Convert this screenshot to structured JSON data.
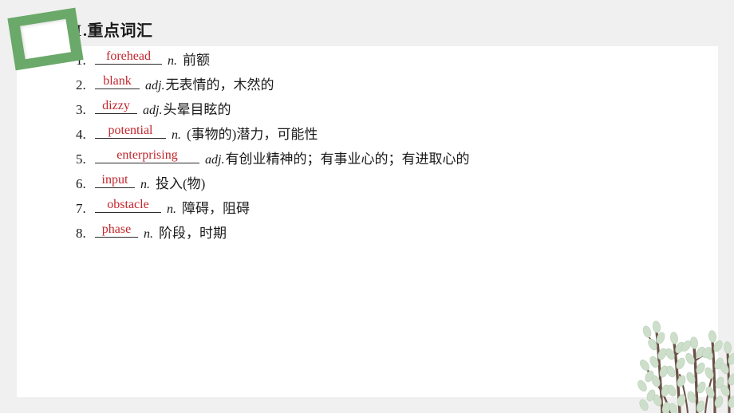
{
  "slide": {
    "background_color": "#f0f0f0",
    "card_color": "#ffffff",
    "accent_green": "#6aa96a",
    "answer_red": "#c1272d",
    "heading": {
      "numeral": "Ⅰ",
      "separator": ".",
      "title": "重点词汇"
    },
    "decorations": {
      "top_left": "green-rotated-frame",
      "bottom_right": "willow-branch-illustration"
    }
  },
  "vocabulary": [
    {
      "num": "1.",
      "answer": "forehead",
      "blank_width": 84,
      "pos": "n.",
      "pos_gap": true,
      "meaning": "前额"
    },
    {
      "num": "2.",
      "answer": "blank",
      "blank_width": 56,
      "pos": "adj.",
      "pos_gap": false,
      "meaning": "无表情的，木然的"
    },
    {
      "num": "3.",
      "answer": "dizzy",
      "blank_width": 53,
      "pos": "adj.",
      "pos_gap": false,
      "meaning": "头晕目眩的"
    },
    {
      "num": "4.",
      "answer": "potential",
      "blank_width": 89,
      "pos": "n.",
      "pos_gap": true,
      "meaning": "(事物的)潜力，可能性"
    },
    {
      "num": "5.",
      "answer": "enterprising",
      "blank_width": 131,
      "pos": "adj.",
      "pos_gap": false,
      "meaning": "有创业精神的；有事业心的；有进取心的"
    },
    {
      "num": "6.",
      "answer": "input",
      "blank_width": 50,
      "pos": "n.",
      "pos_gap": true,
      "meaning": "投入(物)"
    },
    {
      "num": "7.",
      "answer": "obstacle",
      "blank_width": 83,
      "pos": "n.",
      "pos_gap": true,
      "meaning": "障碍，阻碍"
    },
    {
      "num": "8.",
      "answer": "phase",
      "blank_width": 54,
      "pos": "n.",
      "pos_gap": true,
      "meaning": "阶段，时期"
    }
  ]
}
